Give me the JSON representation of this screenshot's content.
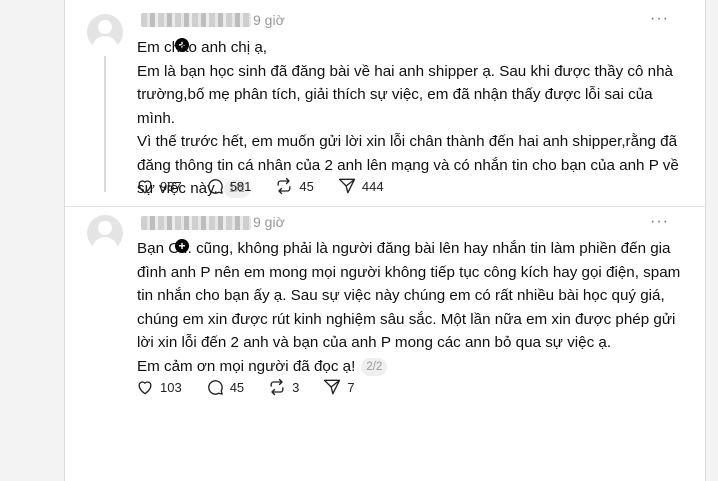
{
  "posts": [
    {
      "time": "9 giờ",
      "more_label": "···",
      "paragraphs": [
        "Em chào anh chị ạ,",
        "Em là bạn học sinh đã đăng bài về hai anh shipper ạ. Sau khi được thầy cô nhà trường,bố mẹ phân tích, giải thích sự việc, em đã nhận thấy được lỗi sai của mình.",
        "Vì thế trước hết, em muốn gửi lời xin lỗi chân thành đến hai anh shipper,rằng đã đăng thông tin cá nhân của 2 anh lên mạng và có nhắn tin cho bạn của anh P về sự việc này."
      ],
      "page_indicator": "1/2",
      "stats": {
        "likes": "987",
        "comments": "581",
        "reposts": "45",
        "shares": "444"
      }
    },
    {
      "time": "9 giờ",
      "more_label": "···",
      "paragraphs": [
        "Bạn C... cũng, không phải là người đăng bài lên hay nhắn tin làm phiền đến gia đình anh P nên em mong mọi người không tiếp tục công kích hay gọi điện, spam tin nhắn cho bạn ấy ạ. Sau sự việc này chúng em có rất nhiều bài học quý giá, chúng em xin được rút kinh nghiệm sâu sắc. Một lần nữa em xin được phép gửi lời xin lỗi đến 2 anh và bạn của anh P mong các ann bỏ qua sự việc ạ.",
        "Em cảm ơn mọi người đã đọc ạ!"
      ],
      "page_indicator": "2/2",
      "stats": {
        "likes": "103",
        "comments": "45",
        "reposts": "3",
        "shares": "7"
      }
    }
  ]
}
